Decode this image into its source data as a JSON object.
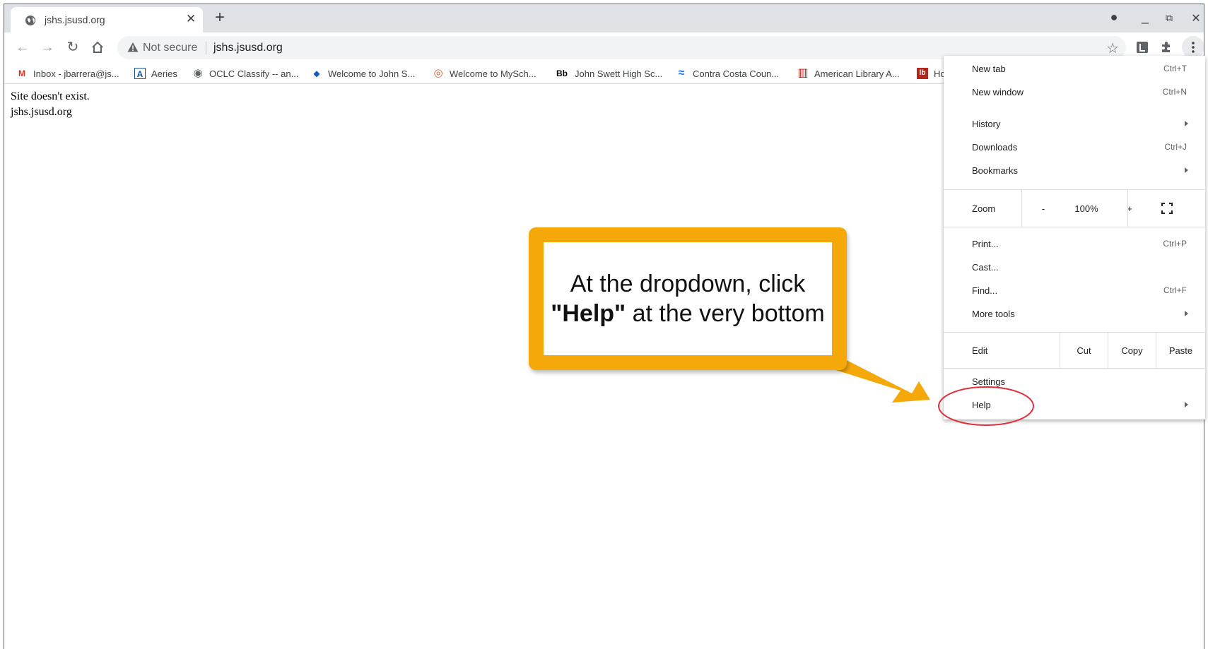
{
  "browser": {
    "tab": {
      "title": "jshs.jsusd.org",
      "close_label": "✕"
    },
    "new_tab_label": "+",
    "window_controls": {
      "account": "●",
      "minimize": "_",
      "restore": "⧉",
      "close": "✕"
    },
    "omnibox": {
      "security_label": "Not secure",
      "url": "jshs.jsusd.org"
    }
  },
  "bookmarks": [
    {
      "label": "Inbox - jbarrera@js...",
      "icon": "gmail-icon",
      "icon_glyph": "M",
      "color": "#d93025"
    },
    {
      "label": "Aeries",
      "icon": "aeries-icon",
      "icon_glyph": "A",
      "color": "#1a4f9c"
    },
    {
      "label": "OCLC Classify -- an...",
      "icon": "globe-icon",
      "icon_glyph": "◉",
      "color": "#5f6368"
    },
    {
      "label": "Welcome to John S...",
      "icon": "flame-icon",
      "icon_glyph": "◆",
      "color": "#1a56c4"
    },
    {
      "label": "Welcome to MySch...",
      "icon": "myschool-icon",
      "icon_glyph": "◎",
      "color": "#e05a2a"
    },
    {
      "label": "John Swett High Sc...",
      "icon": "blackboard-icon",
      "icon_glyph": "Bb",
      "color": "#000000"
    },
    {
      "label": "Contra Costa Coun...",
      "icon": "wave-icon",
      "icon_glyph": "≈",
      "color": "#1a73e8"
    },
    {
      "label": "American Library A...",
      "icon": "book-icon",
      "icon_glyph": "▥",
      "color": "#c5221f"
    },
    {
      "label": "Ho",
      "icon": "lib-icon",
      "icon_glyph": "lb",
      "color": "#b3261e"
    }
  ],
  "page": {
    "line1": "Site doesn't exist.",
    "line2": "jshs.jsusd.org"
  },
  "menu": {
    "new_tab": {
      "label": "New tab",
      "shortcut": "Ctrl+T"
    },
    "new_window": {
      "label": "New window",
      "shortcut": "Ctrl+N"
    },
    "history": {
      "label": "History"
    },
    "downloads": {
      "label": "Downloads",
      "shortcut": "Ctrl+J"
    },
    "bookmarks": {
      "label": "Bookmarks"
    },
    "zoom": {
      "label": "Zoom",
      "minus": "-",
      "value": "100%",
      "plus": "+"
    },
    "print": {
      "label": "Print...",
      "shortcut": "Ctrl+P"
    },
    "cast": {
      "label": "Cast..."
    },
    "find": {
      "label": "Find...",
      "shortcut": "Ctrl+F"
    },
    "more_tools": {
      "label": "More tools"
    },
    "edit": {
      "label": "Edit",
      "cut": "Cut",
      "copy": "Copy",
      "paste": "Paste"
    },
    "settings": {
      "label": "Settings"
    },
    "help": {
      "label": "Help"
    }
  },
  "annotation": {
    "text_before": "At the dropdown, click",
    "text_bold": "\"Help\"",
    "text_after": "at the very bottom",
    "callout_color": "#f5a80a",
    "highlight_color": "#e0303a"
  }
}
